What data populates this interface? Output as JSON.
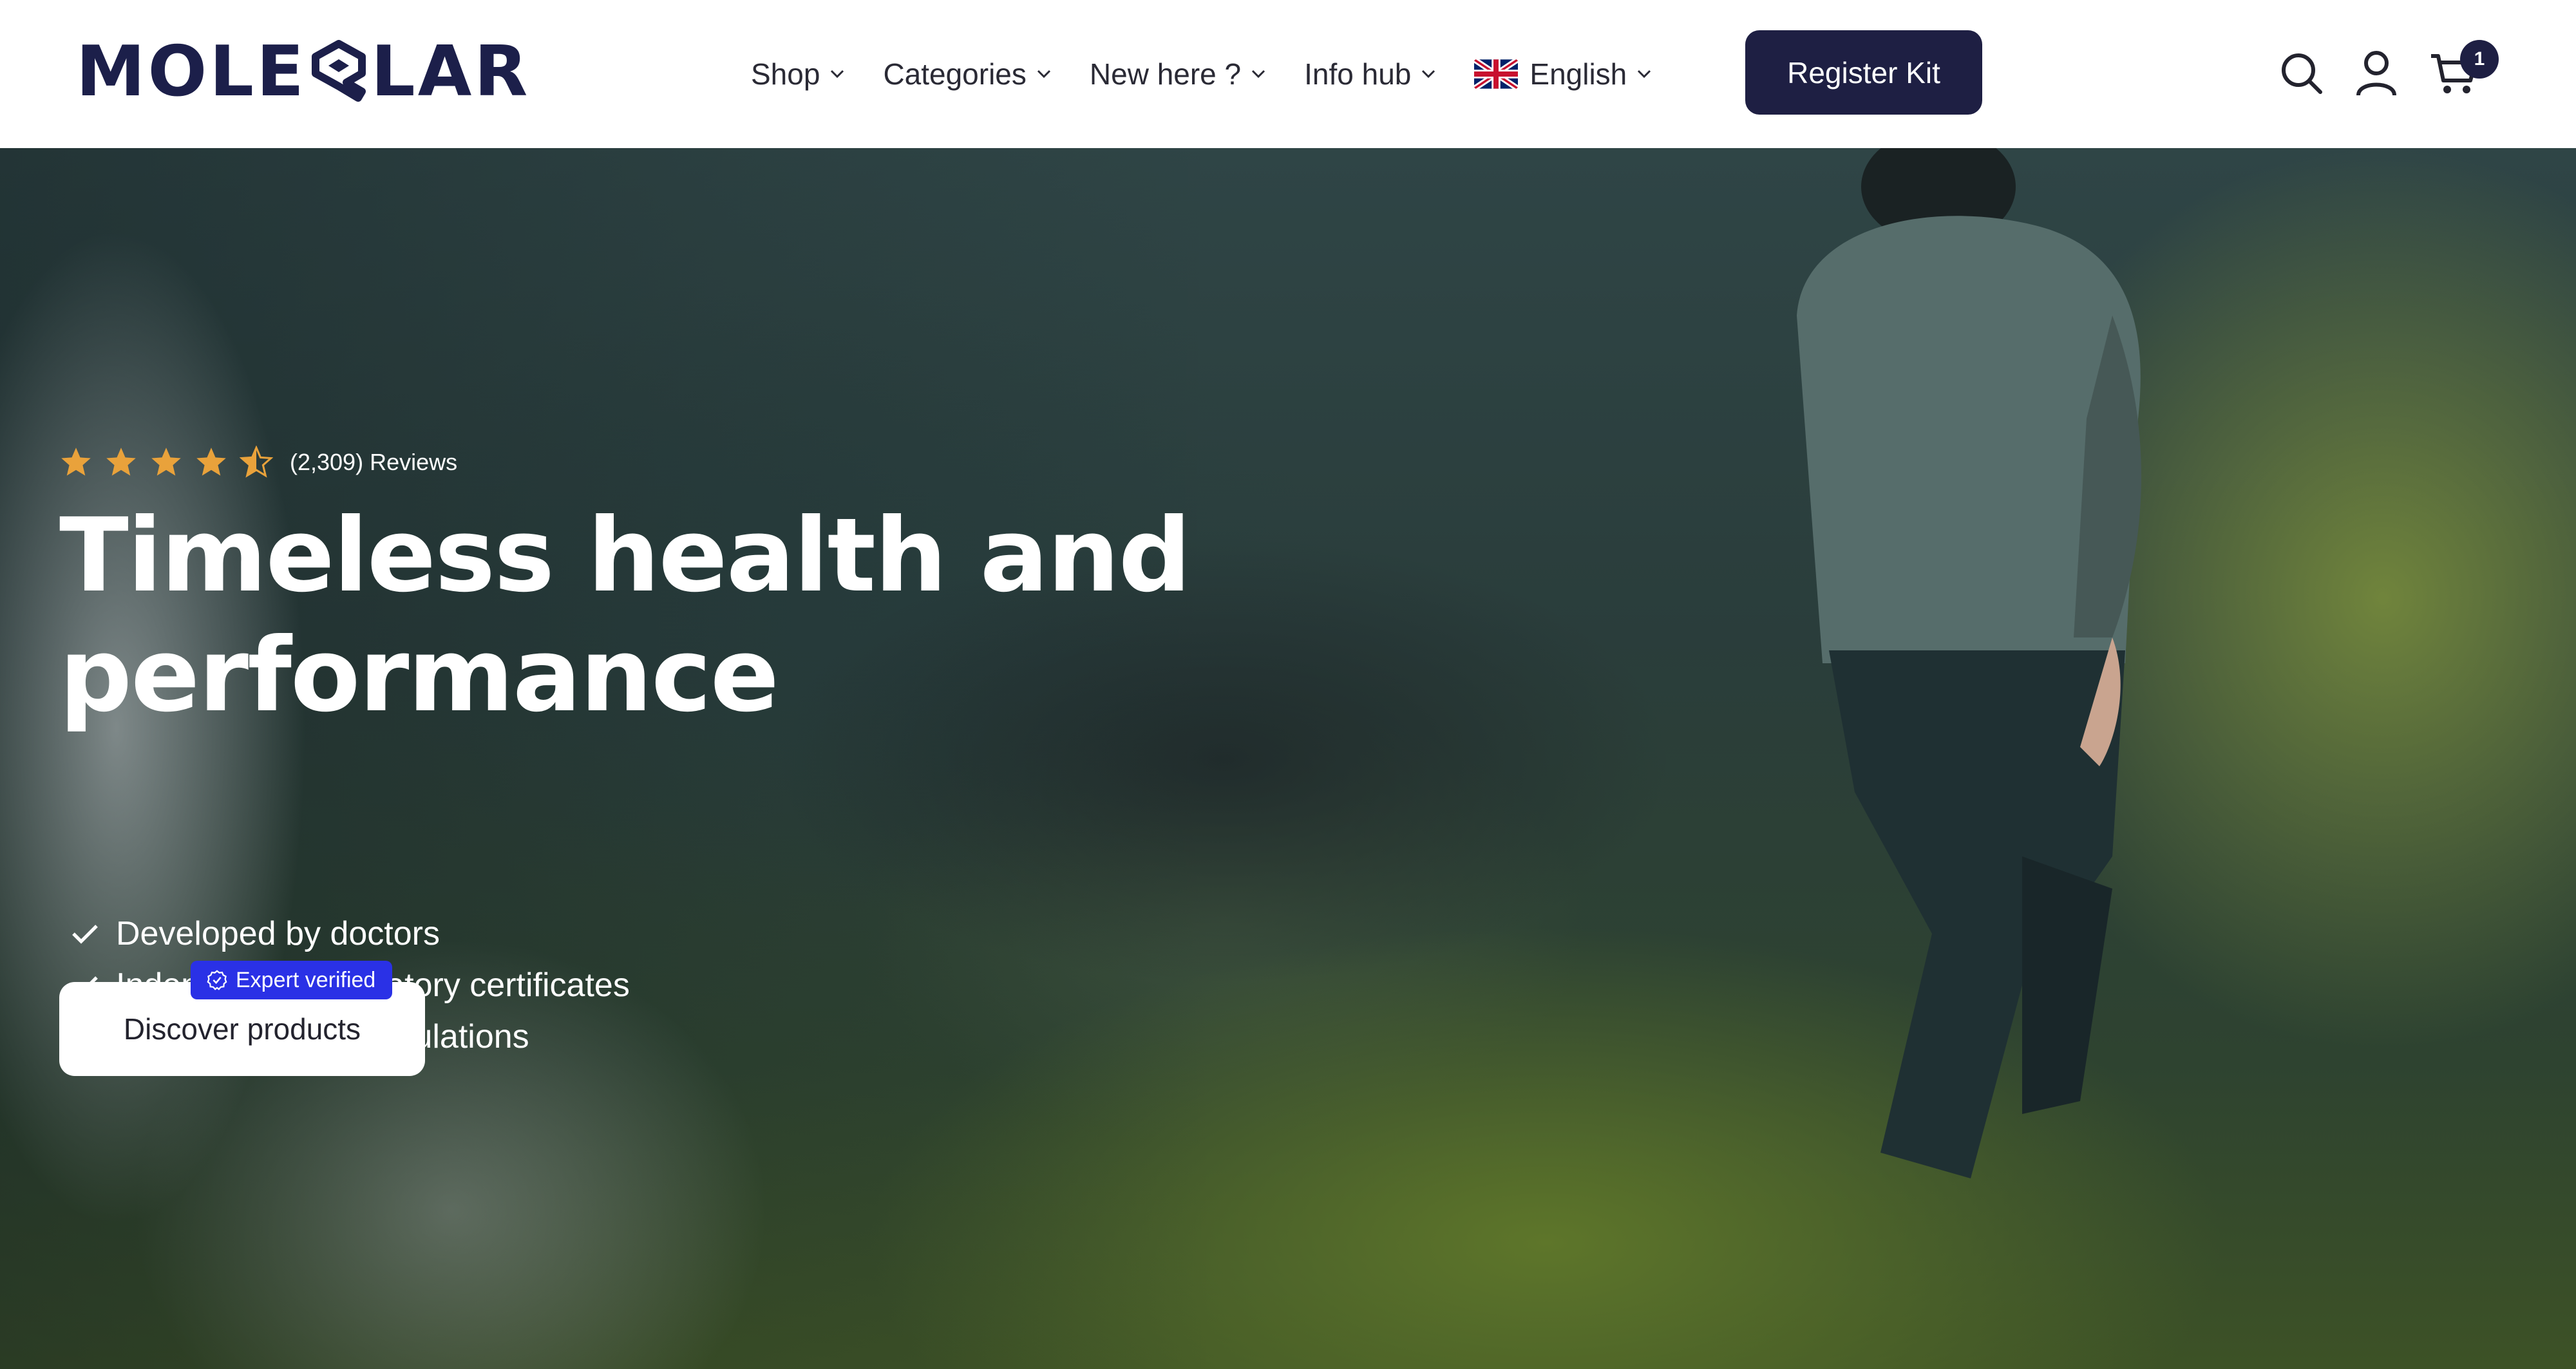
{
  "brand": {
    "name": "MOLECULAR",
    "logo_left": "MOLE",
    "logo_right": "LAR"
  },
  "nav": {
    "items": [
      {
        "label": "Shop"
      },
      {
        "label": "Categories"
      },
      {
        "label": "New here ?"
      },
      {
        "label": "Info hub"
      }
    ],
    "language": {
      "label": "English",
      "flag": "uk-flag-icon"
    },
    "register_label": "Register Kit"
  },
  "header_icons": {
    "search": "search-icon",
    "account": "user-icon",
    "cart": "cart-icon",
    "cart_count": "1"
  },
  "hero": {
    "rating": {
      "stars": 4.5,
      "max": 5,
      "reviews_text": "(2,309) Reviews"
    },
    "title": "Timeless health and performance",
    "features": [
      "Developed by doctors",
      "Independent laboratory certificates",
      "Science-based formulations"
    ],
    "cta_label": "Discover products",
    "badge_label": "Expert verified"
  },
  "colors": {
    "brand_navy": "#1e1f43",
    "badge_blue": "#2a31e6",
    "star_gold": "#e9a23b"
  }
}
